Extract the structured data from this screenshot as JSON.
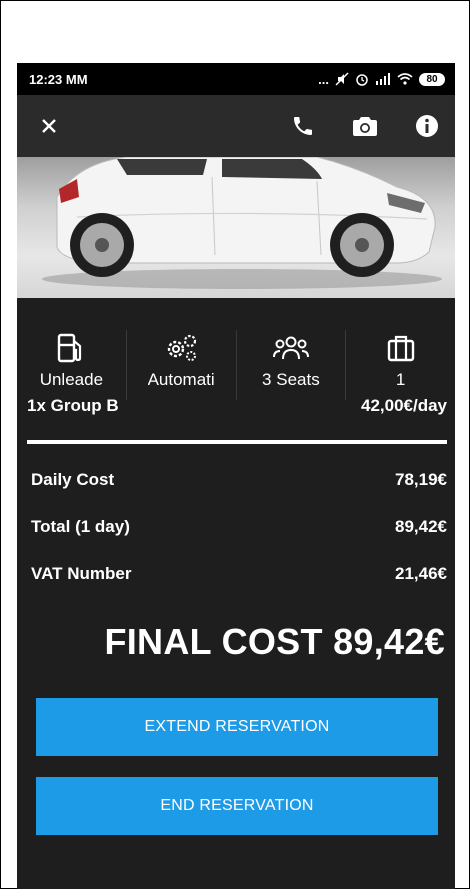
{
  "status_bar": {
    "time": "12:23 MM",
    "indicators": "... ",
    "battery": "80"
  },
  "toolbar": {
    "close_icon": "close-icon",
    "call_icon": "phone-icon",
    "camera_icon": "camera-icon",
    "info_icon": "info-icon"
  },
  "features": [
    {
      "icon": "fuel-icon",
      "label": "Unleade"
    },
    {
      "icon": "gears-icon",
      "label": "Automati"
    },
    {
      "icon": "people-icon",
      "label": "3 Seats"
    },
    {
      "icon": "luggage-icon",
      "label": "1"
    }
  ],
  "group": {
    "label": "1x Group B",
    "price": "42,00€/day"
  },
  "costs": [
    {
      "label": "Daily Cost",
      "value": "78,19€"
    },
    {
      "label": "Total (1 day)",
      "value": "89,42€"
    },
    {
      "label": "VAT Number",
      "value": "21,46€"
    }
  ],
  "final_cost": "FINAL COST 89,42€",
  "buttons": {
    "extend": "EXTEND RESERVATION",
    "end": "END RESERVATION"
  },
  "colors": {
    "background": "#1e1e1e",
    "toolbar": "#2b2b2b",
    "accent": "#1e9be6"
  }
}
